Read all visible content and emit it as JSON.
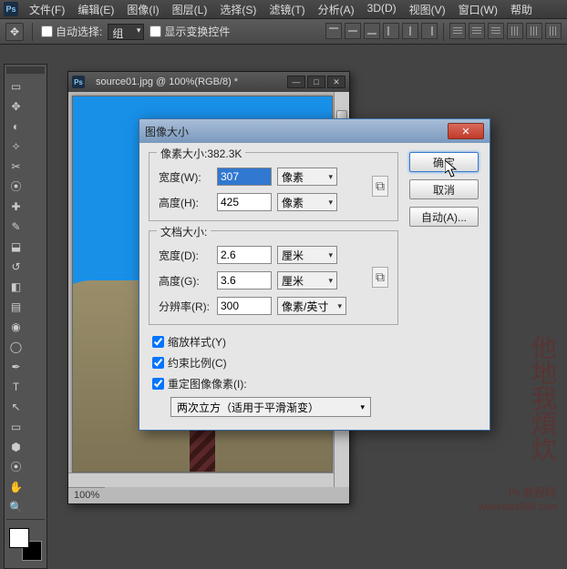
{
  "menubar": [
    "文件(F)",
    "编辑(E)",
    "图像(I)",
    "图层(L)",
    "选择(S)",
    "滤镜(T)",
    "分析(A)",
    "3D(D)",
    "视图(V)",
    "窗口(W)",
    "帮助"
  ],
  "options": {
    "auto_select": "自动选择:",
    "group": "组",
    "show_transform": "显示变换控件"
  },
  "doc": {
    "title": "source01.jpg @ 100%(RGB/8) *",
    "zoom": "100%"
  },
  "dialog": {
    "title": "图像大小",
    "pixel_dim_label": "像素大小:382.3K",
    "width_label": "宽度(W):",
    "width_value": "307",
    "height_label": "高度(H):",
    "height_value": "425",
    "pixel_unit": "像素",
    "doc_size_label": "文档大小:",
    "doc_width_label": "宽度(D):",
    "doc_width_value": "2.6",
    "doc_height_label": "高度(G):",
    "doc_height_value": "3.6",
    "cm_unit": "厘米",
    "res_label": "分辨率(R):",
    "res_value": "300",
    "res_unit": "像素/英寸",
    "scale_styles": "缩放样式(Y)",
    "constrain": "约束比例(C)",
    "resample": "重定图像像素(I):",
    "resample_method": "两次立方（适用于平滑渐变）",
    "ok": "确定",
    "cancel": "取消",
    "auto": "自动(A)..."
  },
  "watermark": {
    "a": "他地我煩炊",
    "b": "PS 教程网",
    "c": "www.tata580.com"
  }
}
